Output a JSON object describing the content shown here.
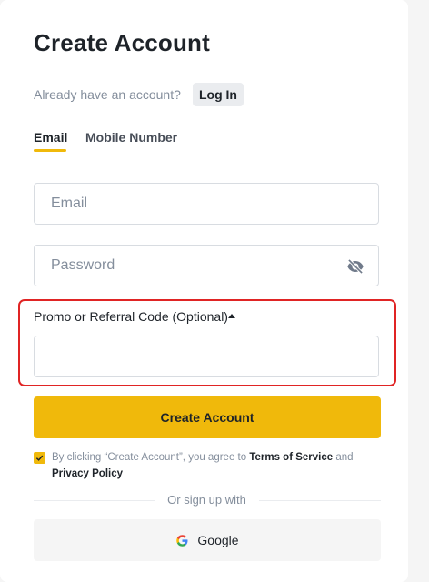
{
  "header": {
    "title": "Create Account",
    "already_text": "Already have an account?",
    "login_label": "Log In"
  },
  "tabs": [
    {
      "label": "Email",
      "active": true
    },
    {
      "label": "Mobile Number",
      "active": false
    }
  ],
  "form": {
    "email": {
      "placeholder": "Email",
      "value": ""
    },
    "password": {
      "placeholder": "Password",
      "value": "",
      "toggle_icon": "eye-slash-icon"
    },
    "promo": {
      "label": "Promo or Referral Code (Optional)",
      "value": "",
      "caret_icon": "caret-up-icon"
    }
  },
  "submit_label": "Create Account",
  "terms": {
    "checked": true,
    "prefix": "By clicking “Create Account”, you agree to ",
    "tos_label": "Terms of Service",
    "and": " and ",
    "privacy_label": "Privacy Policy"
  },
  "divider_text": "Or sign up with",
  "social": {
    "google_label": "Google",
    "google_icon": "google-icon"
  },
  "colors": {
    "accent": "#f0b90b",
    "highlight_border": "#e02424",
    "text_primary": "#1e2329",
    "text_secondary": "#848e9c"
  }
}
